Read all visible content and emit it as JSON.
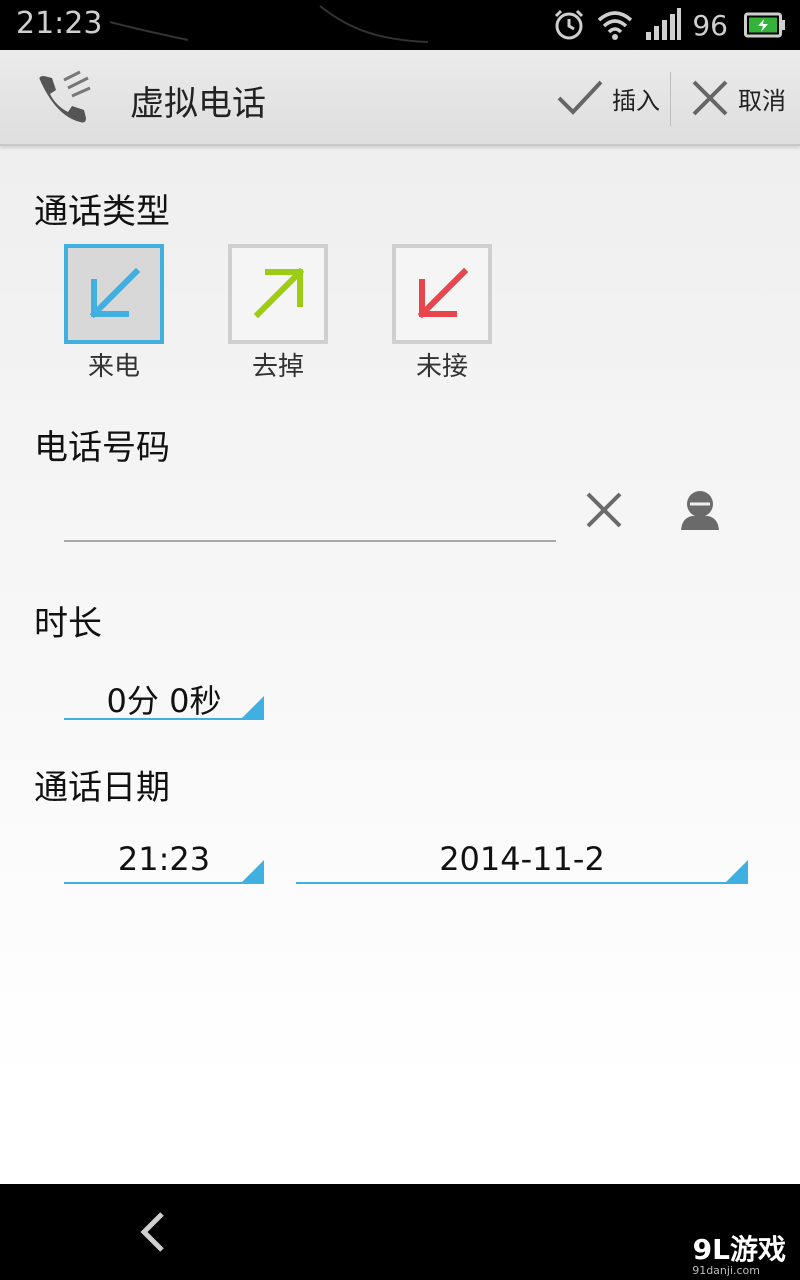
{
  "status_bar": {
    "time": "21:23",
    "battery_level": "96",
    "icons": [
      "alarm-icon",
      "wifi-icon",
      "signal-icon",
      "battery-charging-icon"
    ]
  },
  "action_bar": {
    "title": "虚拟电话",
    "insert_label": "插入",
    "cancel_label": "取消"
  },
  "call_type": {
    "heading": "通话类型",
    "options": [
      {
        "label": "来电",
        "icon": "incoming-call-arrow-icon",
        "color": "#3fb0e0",
        "selected": true
      },
      {
        "label": "去掉",
        "icon": "outgoing-call-arrow-icon",
        "color": "#9ccc14",
        "selected": false
      },
      {
        "label": "未接",
        "icon": "missed-call-arrow-icon",
        "color": "#e8464c",
        "selected": false
      }
    ]
  },
  "phone": {
    "heading": "电话号码",
    "value": ""
  },
  "duration": {
    "heading": "时长",
    "value": "0分 0秒"
  },
  "call_date": {
    "heading": "通话日期",
    "time": "21:23",
    "date": "2014-11-2"
  },
  "watermark": {
    "text": "9L游戏",
    "sub": "91danji.com"
  },
  "colors": {
    "accent": "#3fb0e0",
    "incoming": "#3fb0e0",
    "outgoing": "#9ccc14",
    "missed": "#e8464c"
  }
}
